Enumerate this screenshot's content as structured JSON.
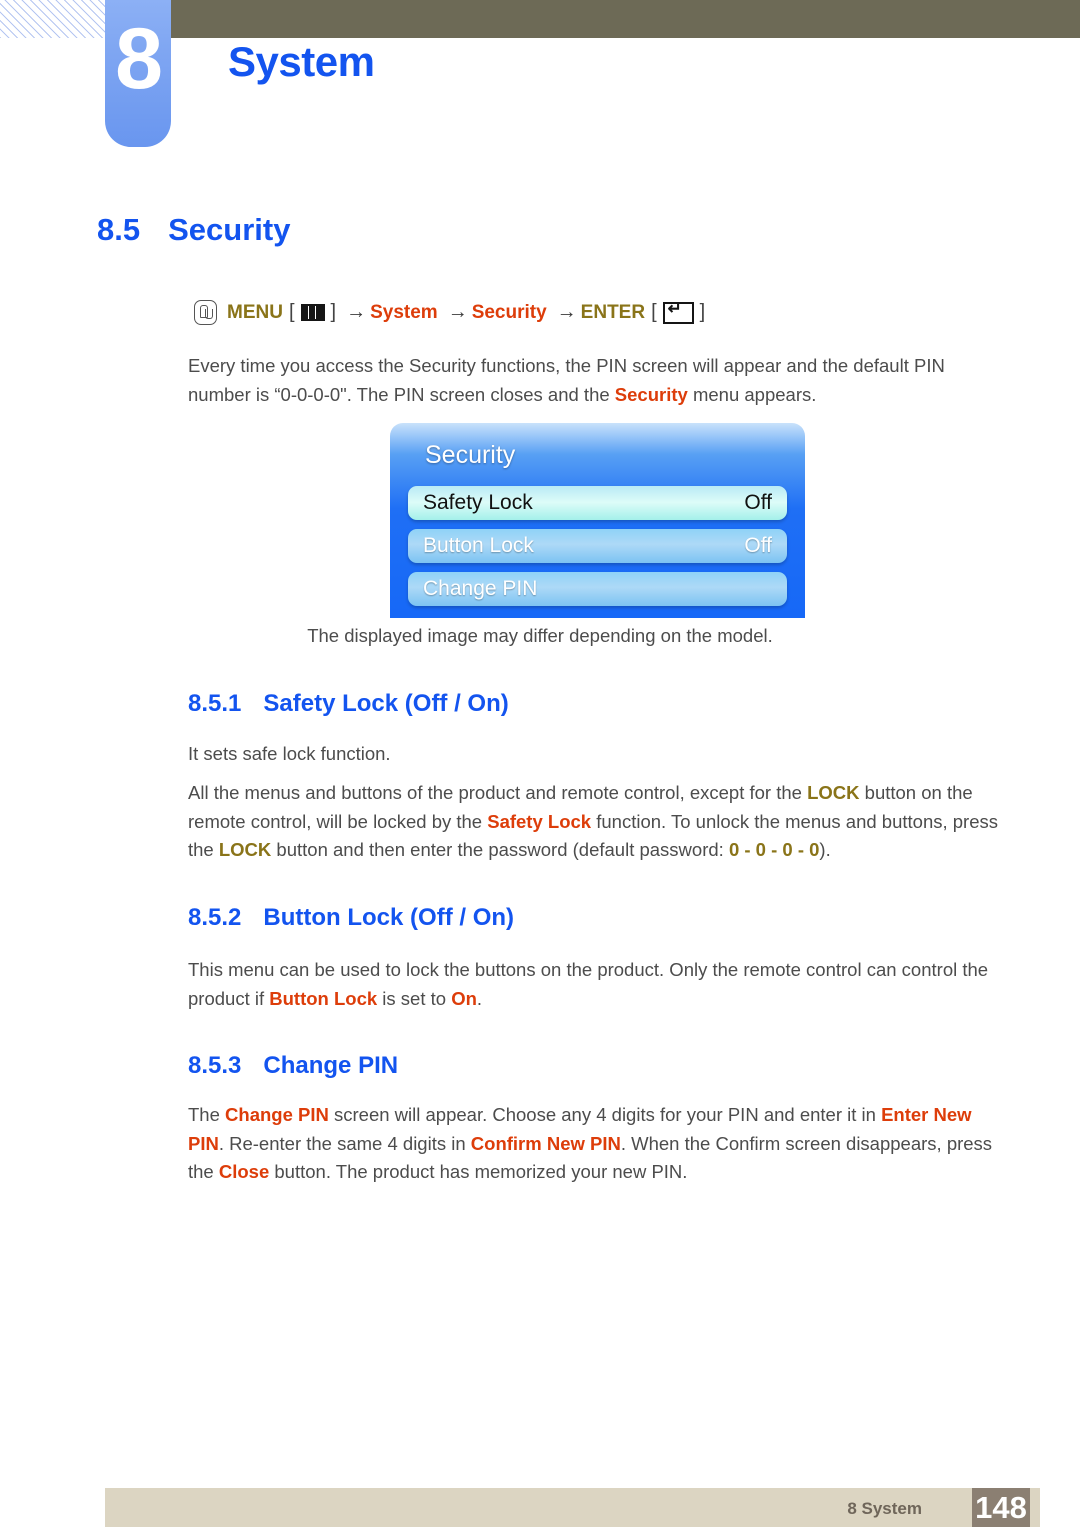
{
  "header": {
    "chapter_number": "8",
    "chapter_title": "System"
  },
  "section": {
    "number": "8.5",
    "title": "Security"
  },
  "menu_path": {
    "hand_icon": "hand-press-icon",
    "menu_label": "MENU",
    "menu_icon": "menu-bars-icon",
    "arrow": "→",
    "bracket_open": "[",
    "bracket_close": "]",
    "item1": "System",
    "item2": "Security",
    "enter_label": "ENTER",
    "enter_icon": "enter-key-icon"
  },
  "intro": {
    "line_a": "Every time you access the Security functions, the PIN screen will appear and the default PIN number is “0-0-0-0\". The PIN screen closes and the ",
    "highlight": "Security",
    "line_b": " menu appears."
  },
  "osd": {
    "title": "Security",
    "rows": [
      {
        "label": "Safety Lock",
        "value": "Off",
        "selected": true
      },
      {
        "label": "Button Lock",
        "value": "Off",
        "selected": false
      },
      {
        "label": "Change PIN",
        "value": "",
        "selected": false
      }
    ],
    "caption": "The displayed image may differ depending on the model."
  },
  "sub1": {
    "number": "8.5.1",
    "title": "Safety Lock (Off / On)",
    "p1": "It sets safe lock function.",
    "p2_a": "All the menus and buttons of the product and remote control, except for the ",
    "p2_lock1": "LOCK",
    "p2_b": " button on the remote control, will be locked by the ",
    "p2_safety": "Safety Lock",
    "p2_c": " function. To unlock the menus and buttons, press the ",
    "p2_lock2": "LOCK",
    "p2_d": " button and then enter the password (default password: ",
    "p2_pin": "0 - 0 - 0 - 0",
    "p2_e": ")."
  },
  "sub2": {
    "number": "8.5.2",
    "title": "Button Lock (Off / On)",
    "p1_a": "This menu can be used to lock the buttons on the product.  Only the remote control can control the product if ",
    "p1_button_lock": "Button Lock",
    "p1_b": " is set to ",
    "p1_on": "On",
    "p1_c": "."
  },
  "sub3": {
    "number": "8.5.3",
    "title": "Change PIN",
    "p1_a": "The ",
    "p1_change_pin": "Change PIN",
    "p1_b": " screen will appear. Choose any 4 digits for your PIN and enter it in ",
    "p1_enter_new": "Enter New PIN",
    "p1_c": ". Re-enter the same 4 digits in ",
    "p1_confirm_new": "Confirm New PIN",
    "p1_d": ". When the Confirm screen disappears, press the ",
    "p1_close": "Close",
    "p1_e": " button. The product has memorized your new PIN."
  },
  "footer": {
    "label": "8 System",
    "page": "148"
  },
  "colors": {
    "accent_blue": "#1354ef",
    "olive_bar": "#6d6a56",
    "tab_blue": "#7fa6f2",
    "red_term": "#dd3d0a",
    "olive_term": "#8a7419",
    "footer_bar": "#dcd5c2",
    "footer_page_box": "#8b7f72"
  }
}
